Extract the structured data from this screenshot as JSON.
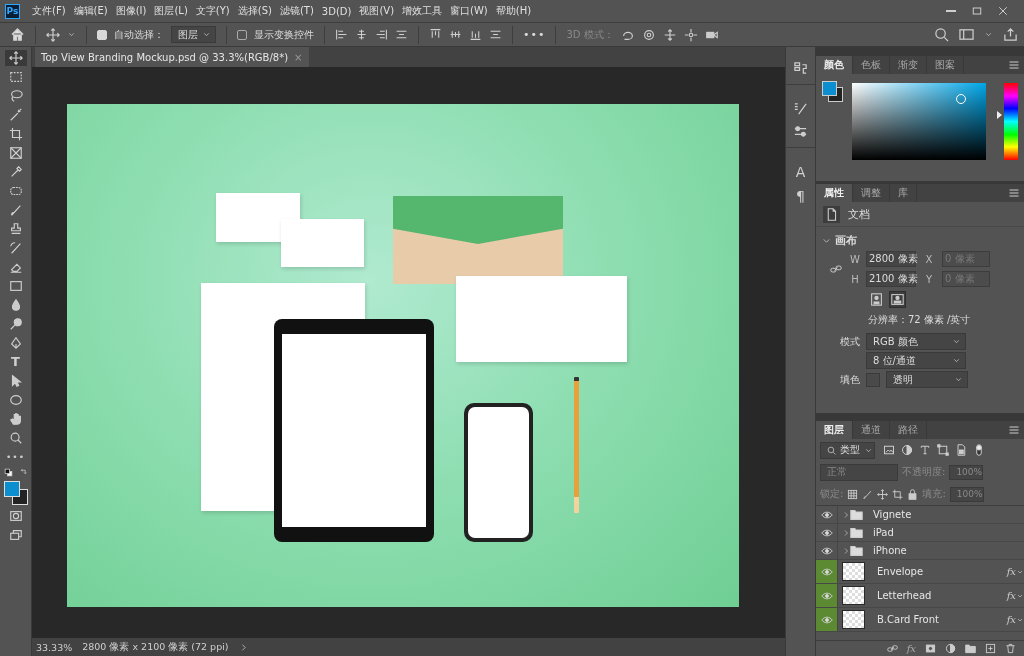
{
  "app": {
    "logo": "Ps"
  },
  "menu": [
    "文件(F)",
    "编辑(E)",
    "图像(I)",
    "图层(L)",
    "文字(Y)",
    "选择(S)",
    "滤镜(T)",
    "3D(D)",
    "视图(V)",
    "增效工具",
    "窗口(W)",
    "帮助(H)"
  ],
  "options_bar": {
    "auto_select": {
      "label": "自动选择：",
      "checked": true
    },
    "target": {
      "value": "图层"
    },
    "show_transform": {
      "label": "显示变换控件",
      "checked": false
    },
    "more": "•••",
    "mode_3d": "3D 模式："
  },
  "toolbar": {
    "type_tool": "T",
    "more": "•••"
  },
  "document_tab": {
    "title": "Top View Branding Mockup.psd @ 33.3%(RGB/8*)",
    "close": "×"
  },
  "status_bar": {
    "zoom": "33.33%",
    "info": "2800 像素 x 2100 像素 (72 ppi)"
  },
  "dock": {
    "character": "A",
    "paragraph": "¶"
  },
  "color_panel": {
    "hue_slider": {
      "level": 0.58
    },
    "tabs": [
      {
        "label": "颜色",
        "selected": true
      },
      {
        "label": "色板",
        "selected": false
      },
      {
        "label": "渐变",
        "selected": false
      },
      {
        "label": "图案",
        "selected": false
      }
    ]
  },
  "properties": {
    "tabs": [
      {
        "label": "属性",
        "selected": true
      },
      {
        "label": "调整",
        "selected": false
      },
      {
        "label": "库",
        "selected": false
      }
    ],
    "doc_label": "文档",
    "section": {
      "title": "画布",
      "expanded": true
    },
    "fields": [
      {
        "label": "W",
        "value": "2800 像素",
        "disabled": false
      },
      {
        "label": "X",
        "value": "0 像素",
        "disabled": true
      },
      {
        "label": "H",
        "value": "2100 像素",
        "disabled": false
      },
      {
        "label": "Y",
        "value": "0 像素",
        "disabled": true
      }
    ],
    "orientation": [
      {
        "kind": "portrait",
        "selected": false
      },
      {
        "kind": "landscape",
        "selected": true
      }
    ],
    "resolution": "分辨率：72 像素 /英寸",
    "mode": {
      "label": "模式",
      "value": "RGB 颜色"
    },
    "depth": {
      "value": "8 位/通道"
    },
    "fill": {
      "label": "填色",
      "value": "透明"
    }
  },
  "layers": {
    "tabs": [
      {
        "label": "图层",
        "selected": true
      },
      {
        "label": "通道",
        "selected": false
      },
      {
        "label": "路径",
        "selected": false
      }
    ],
    "filter": {
      "value": "类型"
    },
    "blend": {
      "value": "正常",
      "disabled": true
    },
    "opacity": {
      "label": "不透明度:",
      "value": "100%"
    },
    "lock_label": "锁定:",
    "fill": {
      "label": "填充:",
      "value": "100%"
    },
    "items": [
      {
        "kind": "group",
        "name": "Vignete",
        "visible": true,
        "expanded": false
      },
      {
        "kind": "group",
        "name": "iPad",
        "visible": true,
        "expanded": false
      },
      {
        "kind": "group",
        "name": "iPhone",
        "visible": true,
        "expanded": false
      },
      {
        "kind": "smart",
        "name": "Envelope",
        "visible": true,
        "color": "#5b8a32",
        "effects": "fx"
      },
      {
        "kind": "smart",
        "name": "Letterhead",
        "visible": true,
        "color": "#5b8a32",
        "effects": "fx"
      },
      {
        "kind": "smart",
        "name": "B.Card Front",
        "visible": true,
        "color": "#5b8a32",
        "effects": "fx"
      }
    ],
    "footer_effects": "fx"
  }
}
